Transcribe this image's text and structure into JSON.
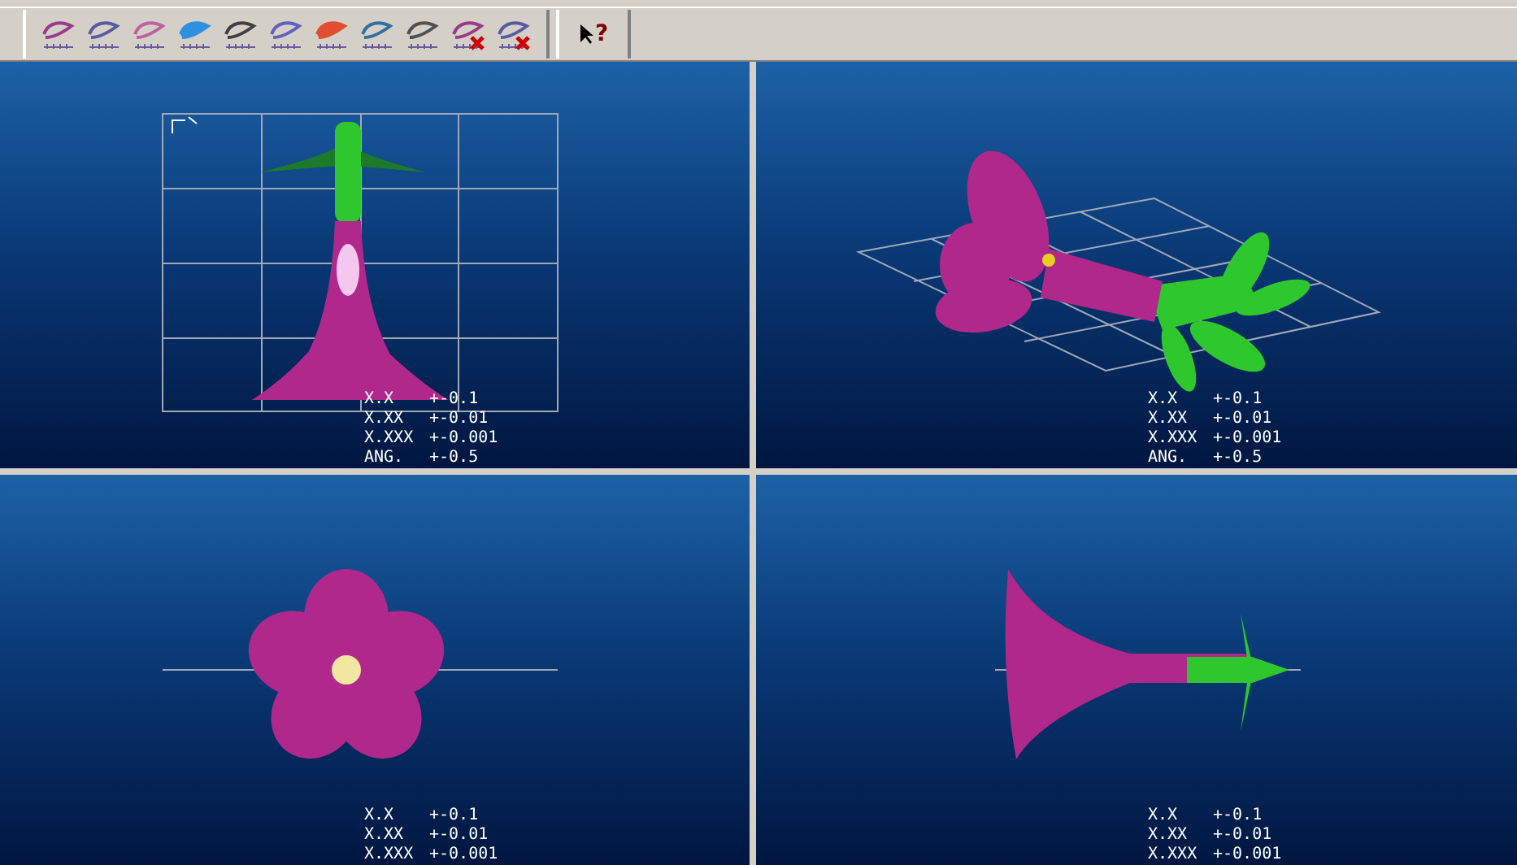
{
  "toolbar": {
    "help_glyph": "?"
  },
  "viewports": [
    {
      "kind": "front",
      "grid": true,
      "tolerances": [
        {
          "format": "X.X",
          "value": "+-0.1"
        },
        {
          "format": "X.XX",
          "value": "+-0.01"
        },
        {
          "format": "X.XXX",
          "value": "+-0.001"
        },
        {
          "format": "ANG.",
          "value": "+-0.5"
        }
      ]
    },
    {
      "kind": "iso",
      "grid": true,
      "tolerances": [
        {
          "format": "X.X",
          "value": "+-0.1"
        },
        {
          "format": "X.XX",
          "value": "+-0.01"
        },
        {
          "format": "X.XXX",
          "value": "+-0.001"
        },
        {
          "format": "ANG.",
          "value": "+-0.5"
        }
      ]
    },
    {
      "kind": "top",
      "grid": false,
      "tolerances": [
        {
          "format": "X.X",
          "value": "+-0.1"
        },
        {
          "format": "X.XX",
          "value": "+-0.01"
        },
        {
          "format": "X.XXX",
          "value": "+-0.001"
        }
      ]
    },
    {
      "kind": "side",
      "grid": false,
      "tolerances": [
        {
          "format": "X.X",
          "value": "+-0.1"
        },
        {
          "format": "X.XX",
          "value": "+-0.01"
        },
        {
          "format": "X.XXX",
          "value": "+-0.001"
        }
      ]
    }
  ]
}
